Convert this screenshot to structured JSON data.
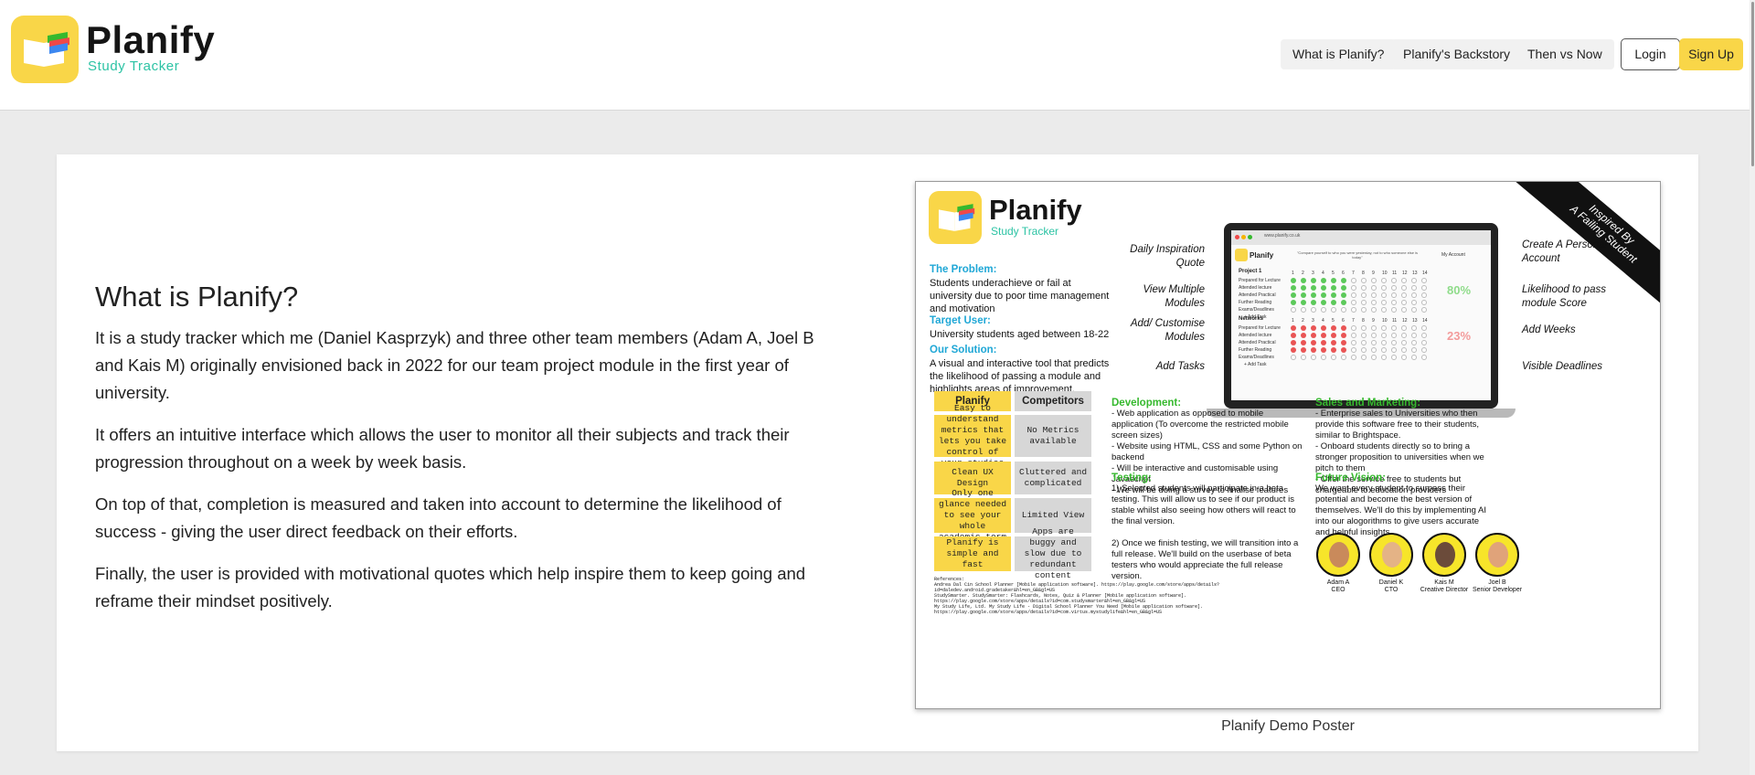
{
  "header": {
    "brand_name": "Planify",
    "brand_subtitle": "Study Tracker",
    "nav": [
      "What is Planify?",
      "Planify's Backstory",
      "Then vs Now"
    ],
    "login_label": "Login",
    "signup_label": "Sign Up"
  },
  "main": {
    "title": "What is Planify?",
    "paragraphs": [
      "It is a study tracker which me (Daniel Kasprzyk) and three other team members (Adam A, Joel B and Kais M) originally envisioned back in 2022 for our team project module in the first year of university.",
      "It offers an intuitive interface which allows the user to monitor all their subjects and track their progression throughout on a week by week basis.",
      "On top of that, completion is measured and taken into account to determine the likelihood of success - giving the user direct feedback on their efforts.",
      "Finally, the user is provided with motivational quotes which help inspire them to keep going and reframe their mindset positively."
    ],
    "poster_caption": "Planify Demo Poster"
  },
  "poster": {
    "title": "Planify",
    "subtitle": "Study Tracker",
    "banner": "Inspired By\nA Failing Student",
    "problem_head": "The Problem:",
    "problem_body": "Students underachieve or fail at university due to poor time management and motivation",
    "target_head": "Target User:",
    "target_body": "University students aged between 18-22",
    "solution_head": "Our Solution:",
    "solution_body": "A visual and interactive tool that predicts the likelihood of passing  a module and highlights areas of improvement.",
    "features_left": [
      "Daily Inspiration Quote",
      "View Multiple Modules",
      "Add/ Customise Modules",
      "Add Tasks"
    ],
    "features_right": [
      "Create A Personal Account",
      "Likelihood to pass module Score",
      "Add Weeks",
      "Visible Deadlines"
    ],
    "screen": {
      "url": "www.planify.co.uk",
      "quote": "\"Compare yourself to who you were yesterday, not to who someone else is today\"",
      "account": "My Account",
      "module1": "Project 1",
      "module1_score": "80%",
      "module2": "Networks",
      "module2_score": "23%",
      "rows": [
        "Prepared for Lecture",
        "Attended lecture",
        "Attended Practical",
        "Further Reading",
        "Exams/Deadlines"
      ],
      "add_task": "+ Add Task",
      "weeks": [
        "1",
        "2",
        "3",
        "4",
        "5",
        "6",
        "7",
        "8",
        "9",
        "10",
        "11",
        "12",
        "13",
        "14"
      ]
    },
    "table": {
      "head_left": "Planify",
      "head_right": "Competitors",
      "rows": [
        [
          "Easy to understand metrics that lets you take control of your studies",
          "No Metrics available"
        ],
        [
          "Clean UX Design",
          "Cluttered and complicated"
        ],
        [
          "Only one glance needed to see your whole academic term",
          "Limited View"
        ],
        [
          "Planify is simple and fast",
          "Apps are buggy and slow due to redundant content"
        ]
      ]
    },
    "development_head": "Development:",
    "development_body": "- Web application as opposed to mobile application (To overcome the restricted mobile screen sizes)\n- Website using HTML, CSS and some Python on backend\n- Will be interactive and customisable using Javascript\n- We will be doing a survey to finalise features",
    "testing_head": "Testing:",
    "testing_body": "1) Selected students will participate in a beta testing. This will allow us to see if our product is stable whilst also seeing how others will react to the final version.\n\n2) Once we finish testing, we will transition into a full release. We'll build on the userbase of beta testers who would appreciate the full release version.",
    "sales_head": "Sales and Marketing:",
    "sales_body": "- Enterprise sales to Universities who then provide this software free to their students, similar to Brightspace.\n- Onboard students directly so to bring a stronger proposition to universities when we pitch to them\n- Offer the service free to students but chargeable to education providers",
    "vision_head": "Future Vision:",
    "vision_body": "We want every student to surpass their potential and become the best version of themselves.  We'll do this by implementing AI into our alogorithms to give users accurate and helpful insights.",
    "team": [
      {
        "name": "Adam A",
        "role": "CEO"
      },
      {
        "name": "Daniel K",
        "role": "CTO"
      },
      {
        "name": "Kais M",
        "role": "Creative Director"
      },
      {
        "name": "Joel B",
        "role": "Senior Developer"
      }
    ],
    "references": "References:\nAndrea Dal Cin School Planner [Mobile application software]. https://play.google.com/store/apps/details?id=daledev.android.gradetaker&hl=en_GB&gl=US\nStudySmarter. StudySmarter: Flashcards, Notes, Quiz & Planner [Mobile application software]. https://play.google.com/store/apps/details?id=com.studysmarter&hl=en_GB&gl=US\nMy Study Life, Ltd. My Study Life - Digital School Planner You Need [Mobile application software]. https://play.google.com/store/apps/details?id=com.virtus.mystudylife&hl=en_GB&gl=US"
  },
  "colors": {
    "brand_yellow": "#f9d648",
    "brand_teal": "#2cc3a4",
    "poster_blue": "#1fa7d6",
    "poster_green": "#36b92e"
  }
}
